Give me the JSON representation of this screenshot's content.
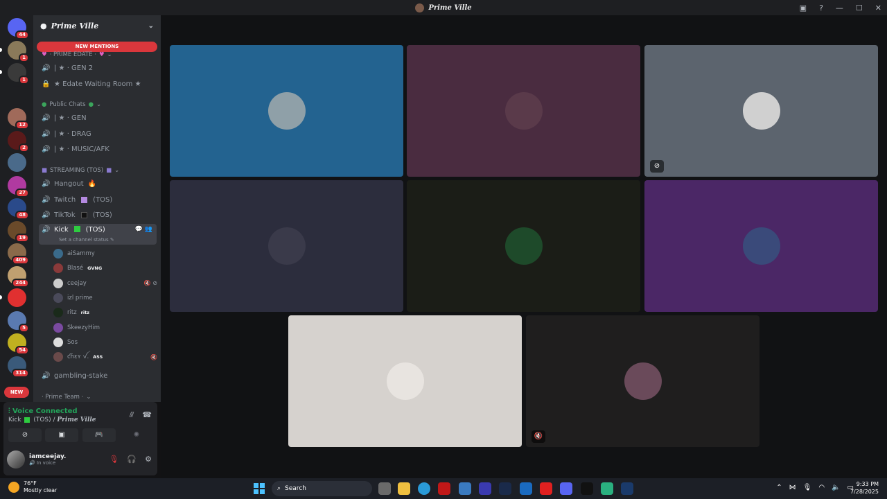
{
  "window": {
    "title": "Prime Ville",
    "help_icon": "?",
    "minimize": "—",
    "maximize": "☐",
    "close": "✕"
  },
  "guilds": [
    {
      "badge": "44",
      "color": "#5865f2",
      "icon": "discord-home-icon"
    },
    {
      "badge": "1",
      "color": "#8a7a5a",
      "icon": "server-icon",
      "pill": true
    },
    {
      "badge": "1",
      "color": "#3a3a3a",
      "icon": "server-icon",
      "pill": true
    },
    {
      "badge": "",
      "color": "#1e1f22",
      "icon": "server-icon"
    },
    {
      "badge": "12",
      "color": "#a06a5a",
      "icon": "server-icon"
    },
    {
      "badge": "2",
      "color": "#5a1a1a",
      "icon": "server-icon"
    },
    {
      "badge": "",
      "color": "#4a6a8a",
      "icon": "server-icon"
    },
    {
      "badge": "27",
      "color": "#b03aa0",
      "icon": "server-icon"
    },
    {
      "badge": "48",
      "color": "#2a4a8a",
      "icon": "server-icon"
    },
    {
      "badge": "19",
      "color": "#6a4a2a",
      "icon": "server-icon"
    },
    {
      "badge": "409",
      "color": "#8a6a4a",
      "icon": "server-icon"
    },
    {
      "badge": "244",
      "color": "#c0a070",
      "icon": "server-icon"
    },
    {
      "badge": "",
      "color": "#e03030",
      "icon": "server-icon",
      "pill": true
    },
    {
      "badge": "5",
      "color": "#5a7ab0",
      "icon": "server-icon"
    },
    {
      "badge": "54",
      "color": "#c0b020",
      "icon": "server-icon"
    },
    {
      "badge": "314",
      "color": "#3a5a7a",
      "icon": "server-icon"
    }
  ],
  "guilds_new": "NEW",
  "server": {
    "name": "Prime Ville",
    "new_mentions": "NEW MENTIONS"
  },
  "categories": {
    "prime_edate": "· PRIME EDATE ·",
    "public_chats": "Public Chats",
    "streaming": "STREAMING (TOS)",
    "prime_team": "· Prime Team ·"
  },
  "channels": {
    "gen2": "| ★ · GEN 2",
    "edate_waiting": "★ Edate Waiting Room ★",
    "gen": "| ★ · GEN",
    "drag": "| ★ · DRAG",
    "music": "| ★ · MUSIC/AFK",
    "hangout": "Hangout",
    "twitch": "Twitch",
    "twitch_tos": "(TOS)",
    "tiktok": "TikTok",
    "tiktok_tos": "(TOS)",
    "kick": "Kick",
    "kick_tos": "(TOS)",
    "kick_status": "Set a channel status ✎",
    "gambling": "gambling-stake"
  },
  "voice_users": [
    {
      "name": "aiSammy",
      "tag": "",
      "color": "#3a6a8a",
      "mute": ""
    },
    {
      "name": "Blasé",
      "tag": "GVNG",
      "color": "#8a3a3a",
      "mute": ""
    },
    {
      "name": "ceejay",
      "tag": "",
      "color": "#cccccc",
      "mute": "🔇 ⊘"
    },
    {
      "name": "izl prime",
      "tag": "",
      "color": "#4a4a5a",
      "mute": ""
    },
    {
      "name": "ritz",
      "tag": "ritz",
      "color": "#1a2a1a",
      "mute": ""
    },
    {
      "name": "SkeezyHim",
      "tag": "",
      "color": "#7a4aa0",
      "mute": ""
    },
    {
      "name": "Sos",
      "tag": "",
      "color": "#dddddd",
      "mute": ""
    },
    {
      "name": "ƈɦɛʏ ꪜ.",
      "tag": "ASS",
      "color": "#6a4a4a",
      "mute": "🔇"
    }
  ],
  "voice_panel": {
    "status": "Voice Connected",
    "channel": "Kick",
    "tos": "(TOS) /",
    "server": "Prime Ville"
  },
  "user": {
    "name": "iamceejay.",
    "status": "In voice"
  },
  "tiles": [
    {
      "bg": "#236390",
      "avatar": "#8fa0a8",
      "icon": ""
    },
    {
      "bg": "#4a2c40",
      "avatar": "#5a3a4a",
      "icon": ""
    },
    {
      "bg": "#5c646e",
      "avatar": "#d0d0d0",
      "icon": "⊘"
    },
    {
      "bg": "#2c2d3d",
      "avatar": "#3a3a4a",
      "icon": ""
    },
    {
      "bg": "#1b1d17",
      "avatar": "#1e4a2a",
      "icon": ""
    },
    {
      "bg": "#4b2766",
      "avatar": "#3a4a7a",
      "icon": ""
    },
    {
      "bg": "#d6d2ce",
      "avatar": "#e8e4e0",
      "icon": ""
    },
    {
      "bg": "#1f1e1e",
      "avatar": "#6a4a5a",
      "icon": "🔇"
    }
  ],
  "taskbar": {
    "temp": "76°F",
    "weather": "Mostly clear",
    "search": "Search",
    "time": "9:33 PM",
    "date": "7/28/2025"
  }
}
